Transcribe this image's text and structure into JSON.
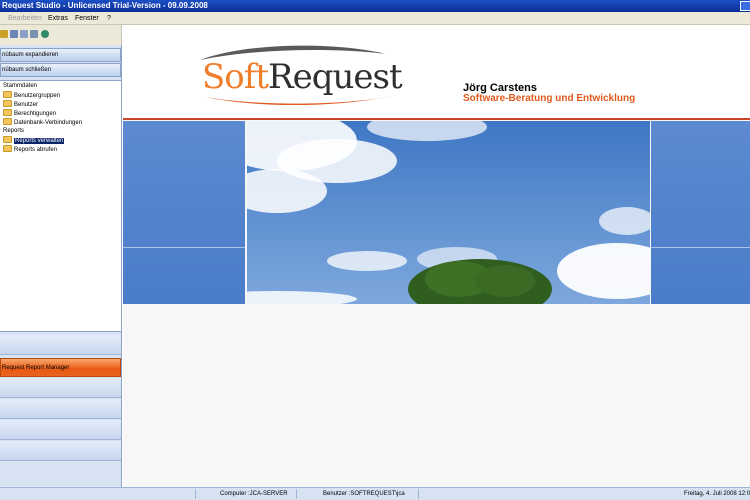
{
  "window": {
    "title": "Request Studio - Unlicensed Trial-Version - 09.09.2008"
  },
  "menu": {
    "items": [
      "Bearbeiten",
      "Extras",
      "Fenster",
      "?"
    ]
  },
  "toolbar": {
    "icons": [
      "folder-open-icon",
      "print-icon",
      "document-icon",
      "list-icon",
      "globe-icon"
    ]
  },
  "sidebar": {
    "buttons": [
      "nübaum expandieren",
      "nübaum schließen"
    ],
    "tree": {
      "root1": "Stammdaten",
      "children1": [
        "Benutzergruppen",
        "Benutzer",
        "Berechtigungen",
        "Datenbank-Verbindungen"
      ],
      "root2": "Reports",
      "children2": [
        "Reports verwalten",
        "Reports abrufen"
      ],
      "selected": "Reports verwalten"
    },
    "active_module": "Request Report Manager"
  },
  "header": {
    "logo_soft": "Soft",
    "logo_request": "Request",
    "author": "Jörg Carstens",
    "tagline": "Software-Beratung und Entwicklung"
  },
  "colors": {
    "accent_orange": "#e05a1e",
    "title_blue": "#0a2f9a",
    "panel_blue": "#4a7cc8"
  },
  "status": {
    "computer": "Computer :JCA-SERVER",
    "user": "Benutzer :SOFTREQUEST\\jca",
    "date": "Freitag, 4. Juli 2008 12:0"
  }
}
